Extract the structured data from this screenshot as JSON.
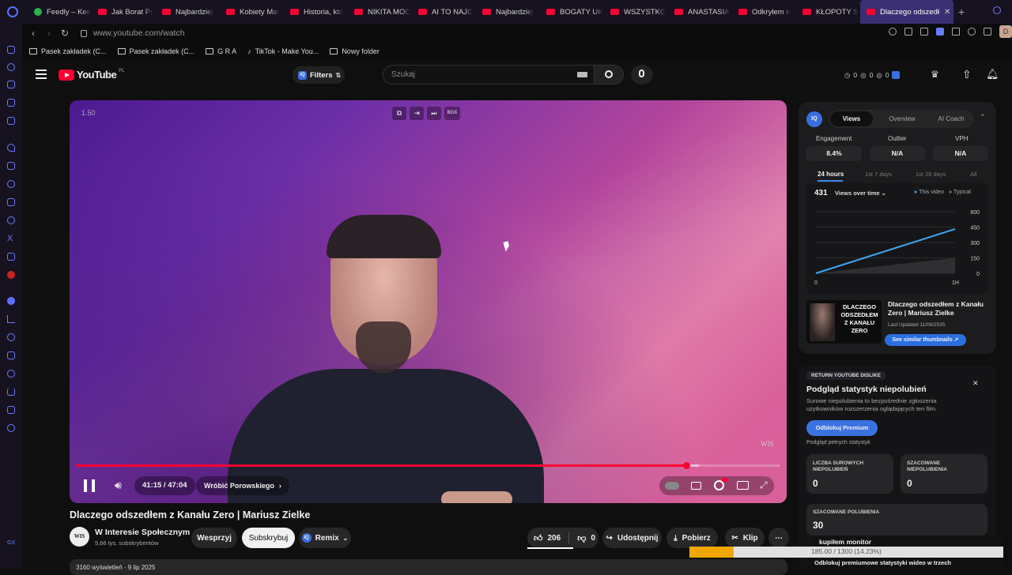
{
  "tabs": [
    {
      "label": "Feedly – Kee",
      "icon": "feedly"
    },
    {
      "label": "Jak Borat Pr",
      "icon": "youtube"
    },
    {
      "label": "Najbardziej",
      "icon": "youtube"
    },
    {
      "label": "Kobiety Mat",
      "icon": "youtube"
    },
    {
      "label": "Historia, któ",
      "icon": "youtube"
    },
    {
      "label": "NIKITA MOC",
      "icon": "youtube"
    },
    {
      "label": "AI TO NAJG",
      "icon": "youtube"
    },
    {
      "label": "Najbardziej",
      "icon": "youtube"
    },
    {
      "label": "BOGATY UK",
      "icon": "youtube"
    },
    {
      "label": "WSZYSTKO",
      "icon": "youtube"
    },
    {
      "label": "ANASTASIA",
      "icon": "youtube"
    },
    {
      "label": "Odkryłem n",
      "icon": "youtube"
    },
    {
      "label": "KŁOPOTY S",
      "icon": "youtube"
    }
  ],
  "active_tab": {
    "label": "Dlaczego odszedł"
  },
  "address": {
    "url": "www.youtube.com/watch"
  },
  "profile_initial": "D",
  "bookmarks": [
    {
      "label": "Pasek zakładek (C..."
    },
    {
      "label": "Pasek zakładek (C..."
    },
    {
      "label": "G R A"
    },
    {
      "label": "TikTok - Make You..."
    },
    {
      "label": "Nowy folder"
    }
  ],
  "yt": {
    "logo": "YouTube",
    "country": "PL",
    "filters_label": "Filters",
    "search_placeholder": "Szukaj",
    "counters": [
      "0",
      "0",
      "0"
    ]
  },
  "player": {
    "speed": "1.50",
    "time": "41:15 / 47:04",
    "chapter": "Wróbić Porowskiego",
    "watermark": "WIS",
    "progress": 0.866,
    "buffer": 0.884,
    "top_badge": "BGX"
  },
  "video": {
    "title": "Dlaczego odszedłem z Kanału Zero | Mariusz Zielke",
    "channel": "W Interesie Społecznym",
    "channel_avatar": "WIS",
    "subscribers": "5,66 tys. subskrybentów",
    "support_label": "Wesprzyj",
    "subscribe_label": "Subskrybuj",
    "remix_label": "Remix",
    "likes": "206",
    "dislikes": "0",
    "share_label": "Udostępnij",
    "download_label": "Pobierz",
    "clip_label": "Klip"
  },
  "vidiq": {
    "badge": "IQ",
    "tabs": [
      "Views",
      "Overview",
      "AI Coach"
    ],
    "metrics": [
      {
        "label": "Engagement",
        "value": "8.4%"
      },
      {
        "label": "Outlier",
        "value": "N/A"
      },
      {
        "label": "VPH",
        "value": "N/A"
      }
    ],
    "periods": [
      "24 hours",
      "1st 7 days",
      "1st 28 days",
      "All"
    ],
    "views": "431",
    "views_label": "Views over time",
    "legend_this": "This video",
    "legend_typical": "Typical",
    "y_ticks": [
      "600",
      "450",
      "300",
      "150",
      "0"
    ],
    "x_ticks": [
      "0",
      "1H"
    ],
    "thumb_text": "DLACZEGO ODSZEDŁEM Z KANAŁU ZERO",
    "video_title": "Dlaczego odszedłem z Kanału Zero | Mariusz Zielke",
    "updated": "Last Updated 11/08/2025",
    "similar_btn": "See similar thumbnails ↗"
  },
  "chart_data": {
    "type": "line",
    "x": [
      0,
      1
    ],
    "series": [
      {
        "name": "This video",
        "values": [
          0,
          431
        ]
      },
      {
        "name": "Typical",
        "values": [
          0,
          150
        ]
      }
    ],
    "ylim": [
      0,
      600
    ],
    "xlabel": "",
    "ylabel": ""
  },
  "ryd": {
    "badge": "RETURN YOUTUBE DISLIKE",
    "title": "Podgląd statystyk niepolubień",
    "desc": "Surowe niepolubienia to bezpośrednie zgłoszenia użytkowników rozszerzenia oglądających ten film.",
    "premium_btn": "Odblokuj Premium",
    "sub": "Podgląd pełnych statystyk",
    "raw_label": "LICZBA SUROWYCH NIEPOLUBIEŃ",
    "raw_value": "0",
    "est_label": "SZACOWANE NIEPOLUBIENIA",
    "est_value": "0",
    "likes_label": "SZACOWANE POLUBIENIA",
    "likes_value": "30"
  },
  "overlay": {
    "title": "kupiłem monitor",
    "progress_text": "185.00 / 1300 (14.23%)",
    "progress_pct": 0.1423,
    "footer": "Odblokuj premiumowe statystyki wideo w trzech"
  },
  "description_line": "3160 wyświetleń · 9 lip 2025"
}
